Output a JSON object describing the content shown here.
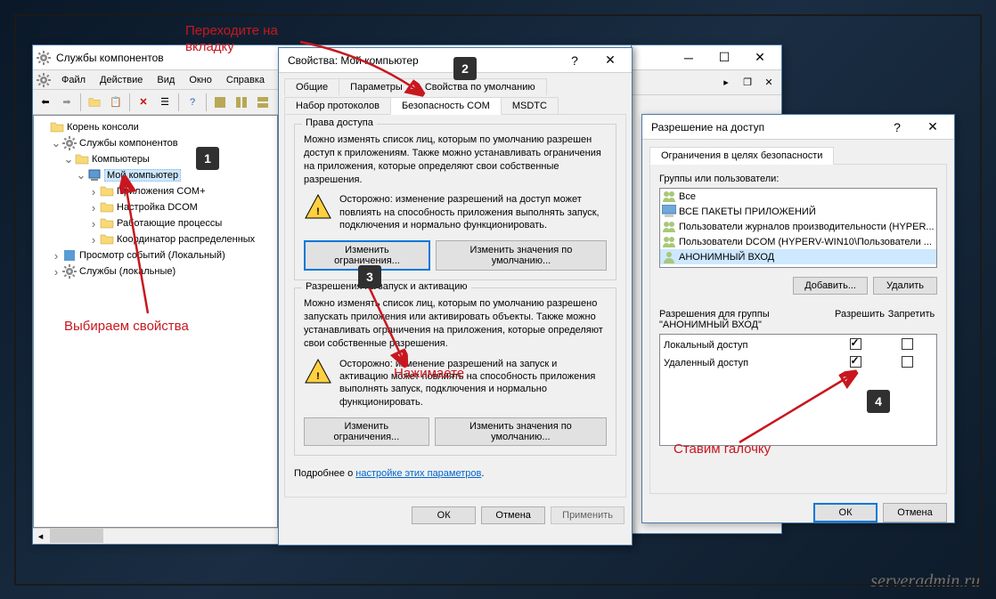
{
  "watermark": "serveradmin.ru",
  "annotations": {
    "top": "Переходите на\nвкладку",
    "left": "Выбираем свойства",
    "mid": "Нажимаете",
    "right": "Ставим галочку"
  },
  "mainWin": {
    "title": "Службы компонентов",
    "menu": [
      "Файл",
      "Действие",
      "Вид",
      "Окно",
      "Справка"
    ],
    "tree": {
      "root": "Корень консоли",
      "svc": "Службы компонентов",
      "computers": "Компьютеры",
      "mycomp": "Мой компьютер",
      "comapps": "Приложения COM+",
      "dcom": "Настройка DCOM",
      "running": "Работающие процессы",
      "coord": "Координатор распределенных",
      "eventvwr": "Просмотр событий (Локальный)",
      "services": "Службы (локальные)"
    }
  },
  "propWin": {
    "title": "Свойства: Мой компьютер",
    "tabs1": [
      "Общие",
      "Параметры",
      "Свойства по умолчанию"
    ],
    "tabs2": [
      "Набор протоколов",
      "Безопасность COM",
      "MSDTC"
    ],
    "group1": {
      "legend": "Права доступа",
      "text": "Можно изменять список лиц, которым по умолчанию разрешен доступ к приложениям. Также можно устанавливать ограничения на приложения, которые определяют свои собственные разрешения.",
      "warn": "Осторожно: изменение разрешений на доступ может повлиять на способность приложения выполнять запуск, подключения и нормально функционировать.",
      "btn1": "Изменить ограничения...",
      "btn2": "Изменить значения по умолчанию..."
    },
    "group2": {
      "legend": "Разрешения на запуск и активацию",
      "text": "Можно изменять список лиц, которым по умолчанию разрешено запускать приложения или активировать объекты. Также можно устанавливать ограничения на приложения, которые определяют свои собственные разрешения.",
      "warn": "Осторожно: изменение разрешений на запуск и активацию может повлиять на способность приложения выполнять запуск, подключения и нормально функционировать.",
      "btn1": "Изменить ограничения...",
      "btn2": "Изменить значения по умолчанию..."
    },
    "moreInfo1": "Подробнее о ",
    "moreInfo2": "настройке этих параметров",
    "ok": "ОК",
    "cancel": "Отмена",
    "apply": "Применить"
  },
  "permWin": {
    "title": "Разрешение на доступ",
    "tab": "Ограничения в целях безопасности",
    "groupsLabel": "Группы или пользователи:",
    "groups": [
      "Все",
      "ВСЕ ПАКЕТЫ ПРИЛОЖЕНИЙ",
      "Пользователи журналов производительности (HYPER...",
      "Пользователи DCOM (HYPERV-WIN10\\Пользователи ...",
      "АНОНИМНЫЙ ВХОД"
    ],
    "addBtn": "Добавить...",
    "delBtn": "Удалить",
    "permsFor": "Разрешения для группы\n\"АНОНИМНЫЙ ВХОД\"",
    "allow": "Разрешить",
    "deny": "Запретить",
    "perm1": "Локальный доступ",
    "perm2": "Удаленный доступ",
    "ok": "ОК",
    "cancel": "Отмена"
  }
}
